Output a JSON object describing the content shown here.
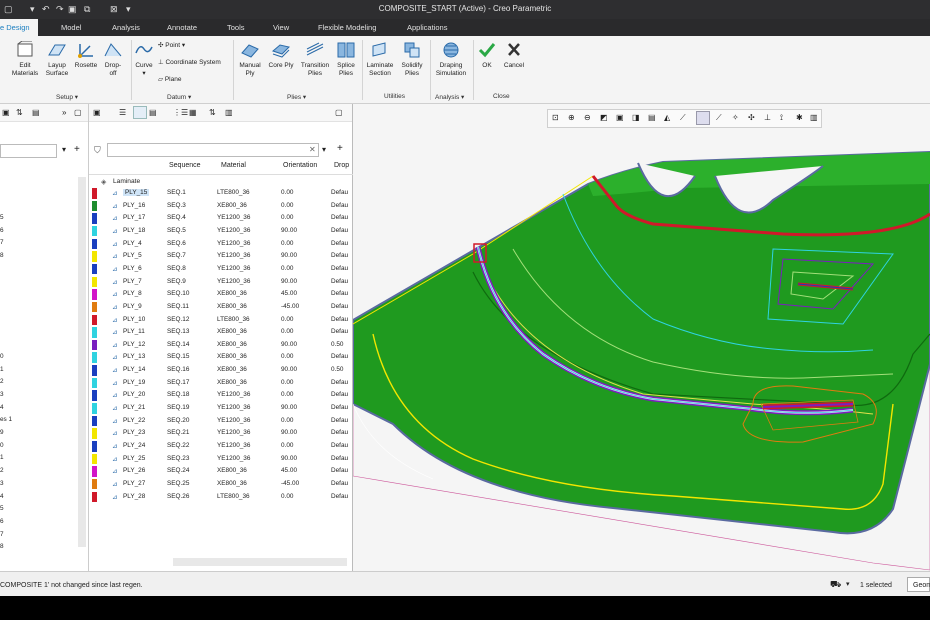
{
  "window": {
    "title": "COMPOSITE_START (Active) - Creo Parametric"
  },
  "tabs": [
    {
      "label": "e Design",
      "active": true
    },
    {
      "label": "Model"
    },
    {
      "label": "Analysis"
    },
    {
      "label": "Annotate"
    },
    {
      "label": "Tools"
    },
    {
      "label": "View"
    },
    {
      "label": "Flexible Modeling"
    },
    {
      "label": "Applications"
    }
  ],
  "ribbon": {
    "edit_materials": "Edit\nMaterials",
    "layup_surface": "Layup\nSurface",
    "rosette": "Rosette",
    "dropoff": "Drop-\noff",
    "curve": "Curve",
    "point": "Point",
    "coord_system": "Coordinate System",
    "plane": "Plane",
    "manual_ply": "Manual\nPly",
    "core_ply": "Core Ply",
    "transition_plies": "Transition\nPlies",
    "splice_plies": "Splice\nPlies",
    "laminate_section": "Laminate\nSection",
    "solidify_plies": "Solidify\nPlies",
    "draping_simulation": "Draping\nSimulation",
    "ok": "OK",
    "cancel": "Cancel",
    "groups": {
      "setup": "Setup ▾",
      "datum": "Datum ▾",
      "plies": "Plies ▾",
      "utilities": "Utilities",
      "analysis": "Analysis ▾",
      "close": "Close"
    }
  },
  "left_tree_labels": [
    "5",
    "6",
    "7",
    "8",
    "0",
    "1",
    "2",
    "3",
    "4",
    "es 1",
    "9",
    "0",
    "1",
    "2",
    "3",
    "4",
    "5",
    "6",
    "7",
    "8"
  ],
  "table": {
    "root": "Laminate",
    "headers": {
      "sequence": "Sequence",
      "material": "Material",
      "orientation": "Orientation",
      "drop": "Drop"
    },
    "rows": [
      {
        "name": "PLY_15",
        "seq": "SEQ.1",
        "mat": "LTE800_36",
        "ori": "0.00",
        "drop": "Defau",
        "color": "#d0192a"
      },
      {
        "name": "PLY_16",
        "seq": "SEQ.3",
        "mat": "XE800_36",
        "ori": "0.00",
        "drop": "Defau",
        "color": "#1e8c2e"
      },
      {
        "name": "PLY_17",
        "seq": "SEQ.4",
        "mat": "YE1200_36",
        "ori": "0.00",
        "drop": "Defau",
        "color": "#1a3fbf"
      },
      {
        "name": "PLY_18",
        "seq": "SEQ.5",
        "mat": "YE1200_36",
        "ori": "90.00",
        "drop": "Defau",
        "color": "#2fd3e0"
      },
      {
        "name": "PLY_4",
        "seq": "SEQ.6",
        "mat": "YE1200_36",
        "ori": "0.00",
        "drop": "Defau",
        "color": "#1a3fbf"
      },
      {
        "name": "PLY_5",
        "seq": "SEQ.7",
        "mat": "YE1200_36",
        "ori": "90.00",
        "drop": "Defau",
        "color": "#f2e600"
      },
      {
        "name": "PLY_6",
        "seq": "SEQ.8",
        "mat": "YE1200_36",
        "ori": "0.00",
        "drop": "Defau",
        "color": "#1a3fbf"
      },
      {
        "name": "PLY_7",
        "seq": "SEQ.9",
        "mat": "YE1200_36",
        "ori": "90.00",
        "drop": "Defau",
        "color": "#f2e600"
      },
      {
        "name": "PLY_8",
        "seq": "SEQ.10",
        "mat": "XE800_36",
        "ori": "45.00",
        "drop": "Defau",
        "color": "#d214c8"
      },
      {
        "name": "PLY_9",
        "seq": "SEQ.11",
        "mat": "XE800_36",
        "ori": "-45.00",
        "drop": "Defau",
        "color": "#e07b10"
      },
      {
        "name": "PLY_10",
        "seq": "SEQ.12",
        "mat": "LTE800_36",
        "ori": "0.00",
        "drop": "Defau",
        "color": "#d0192a"
      },
      {
        "name": "PLY_11",
        "seq": "SEQ.13",
        "mat": "XE800_36",
        "ori": "0.00",
        "drop": "Defau",
        "color": "#2fd3e0"
      },
      {
        "name": "PLY_12",
        "seq": "SEQ.14",
        "mat": "XE800_36",
        "ori": "90.00",
        "drop": "0.50",
        "color": "#7a1fbf"
      },
      {
        "name": "PLY_13",
        "seq": "SEQ.15",
        "mat": "XE800_36",
        "ori": "0.00",
        "drop": "Defau",
        "color": "#2fd3e0"
      },
      {
        "name": "PLY_14",
        "seq": "SEQ.16",
        "mat": "XE800_36",
        "ori": "90.00",
        "drop": "0.50",
        "color": "#1a3fbf"
      },
      {
        "name": "PLY_19",
        "seq": "SEQ.17",
        "mat": "XE800_36",
        "ori": "0.00",
        "drop": "Defau",
        "color": "#2fd3e0"
      },
      {
        "name": "PLY_20",
        "seq": "SEQ.18",
        "mat": "YE1200_36",
        "ori": "0.00",
        "drop": "Defau",
        "color": "#1a3fbf"
      },
      {
        "name": "PLY_21",
        "seq": "SEQ.19",
        "mat": "YE1200_36",
        "ori": "90.00",
        "drop": "Defau",
        "color": "#2fd3e0"
      },
      {
        "name": "PLY_22",
        "seq": "SEQ.20",
        "mat": "YE1200_36",
        "ori": "0.00",
        "drop": "Defau",
        "color": "#1a3fbf"
      },
      {
        "name": "PLY_23",
        "seq": "SEQ.21",
        "mat": "YE1200_36",
        "ori": "90.00",
        "drop": "Defau",
        "color": "#f2e600"
      },
      {
        "name": "PLY_24",
        "seq": "SEQ.22",
        "mat": "YE1200_36",
        "ori": "0.00",
        "drop": "Defau",
        "color": "#1a3fbf"
      },
      {
        "name": "PLY_25",
        "seq": "SEQ.23",
        "mat": "YE1200_36",
        "ori": "90.00",
        "drop": "Defau",
        "color": "#f2e600"
      },
      {
        "name": "PLY_26",
        "seq": "SEQ.24",
        "mat": "XE800_36",
        "ori": "45.00",
        "drop": "Defau",
        "color": "#d214c8"
      },
      {
        "name": "PLY_27",
        "seq": "SEQ.25",
        "mat": "XE800_36",
        "ori": "-45.00",
        "drop": "Defau",
        "color": "#e07b10"
      },
      {
        "name": "PLY_28",
        "seq": "SEQ.26",
        "mat": "LTE800_36",
        "ori": "0.00",
        "drop": "Defau",
        "color": "#d0192a"
      }
    ]
  },
  "status": {
    "message": "COMPOSITE 1' not changed since last regen.",
    "selected": "1 selected",
    "filter": "Geom"
  }
}
